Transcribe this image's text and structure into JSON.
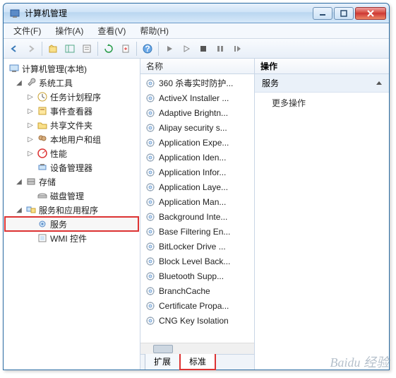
{
  "titlebar": {
    "title": "计算机管理"
  },
  "menu": {
    "file": "文件(F)",
    "action": "操作(A)",
    "view": "查看(V)",
    "help": "帮助(H)"
  },
  "tree": {
    "root": "计算机管理(本地)",
    "system_tools": "系统工具",
    "task_scheduler": "任务计划程序",
    "event_viewer": "事件查看器",
    "shared_folders": "共享文件夹",
    "local_users": "本地用户和组",
    "performance": "性能",
    "device_manager": "设备管理器",
    "storage": "存储",
    "disk_mgmt": "磁盘管理",
    "services_apps": "服务和应用程序",
    "services": "服务",
    "wmi": "WMI 控件"
  },
  "list_header": "名称",
  "services_list": [
    "360 杀毒实时防护...",
    "ActiveX Installer ...",
    "Adaptive Brightn...",
    "Alipay security s...",
    "Application Expe...",
    "Application Iden...",
    "Application Infor...",
    "Application Laye...",
    "Application Man...",
    "Background Inte...",
    "Base Filtering En...",
    "BitLocker Drive ...",
    "Block Level Back...",
    "Bluetooth Supp...",
    "BranchCache",
    "Certificate Propa...",
    "CNG Key Isolation"
  ],
  "tabs": {
    "extended": "扩展",
    "standard": "标准"
  },
  "right": {
    "header": "操作",
    "section": "服务",
    "more": "更多操作"
  },
  "watermark": "Baidu 经验"
}
